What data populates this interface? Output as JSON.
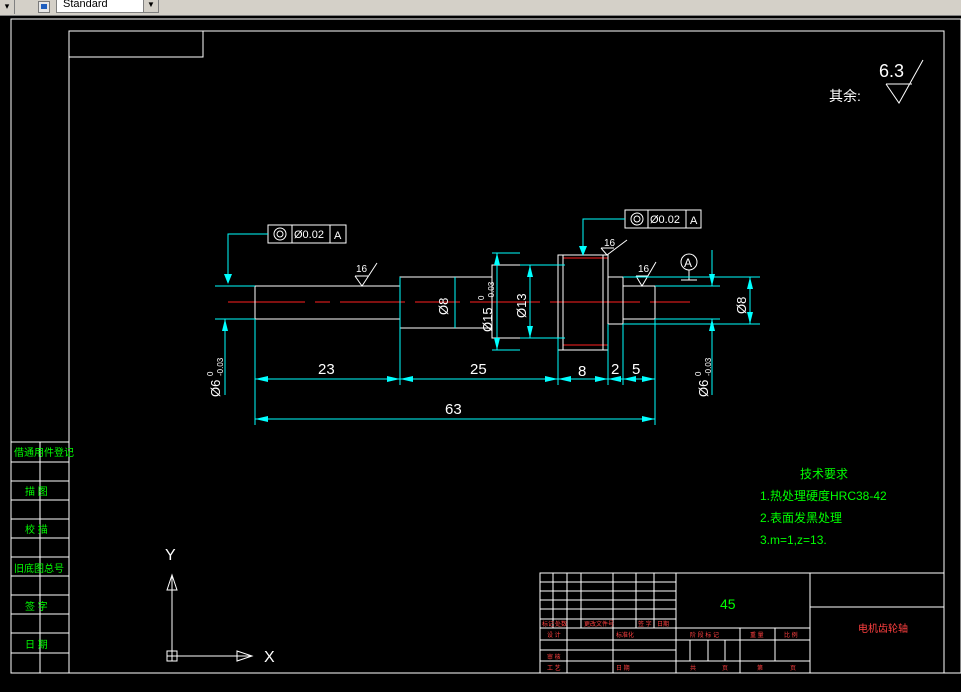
{
  "toolbar": {
    "style_combo_value": "Standard"
  },
  "drawing": {
    "surface_finish_note": "其余:",
    "surface_finish_value": "6.3",
    "roughness_label": "16",
    "tolerance_frame": {
      "value": "Ø0.02",
      "datum": "A"
    },
    "datum_marker": "A",
    "dimensions": {
      "d23": "23",
      "d25": "25",
      "d8": "8",
      "d2": "2",
      "d5": "5",
      "d63": "63",
      "dia8_mid": "Ø8",
      "dia15": "Ø15",
      "dia15_tol_top": "0",
      "dia15_tol_bot": "-0.03",
      "dia13": "Ø13",
      "dia8_right": "Ø8",
      "dia6": "Ø6",
      "dia6_tol_top": "0",
      "dia6_tol_bot": "-0.03"
    },
    "tech_requirements": {
      "title": "技术要求",
      "items": [
        "1.热处理硬度HRC38-42",
        "2.表面发黑处理",
        "3.m=1,z=13."
      ]
    },
    "left_panel_labels": [
      "借通用件登记",
      "描  图",
      "校  描",
      "旧底图总号",
      "签  字",
      "日  期"
    ],
    "ucs": {
      "x": "X",
      "y": "Y"
    },
    "title_block": {
      "material": "45",
      "part_name": "电机齿轮轴",
      "row_labels": [
        "标记",
        "处数",
        "更改文件号",
        "签 字",
        "日期"
      ],
      "design": "设 计",
      "standardization": "标准化",
      "stage_mark": "阶 段 标 记",
      "weight": "重 量",
      "scale": "比 例",
      "review": "审 核",
      "process": "工 艺",
      "date": "日 期",
      "total": "共",
      "sheet": "页",
      "no": "第",
      "page": "页"
    }
  }
}
